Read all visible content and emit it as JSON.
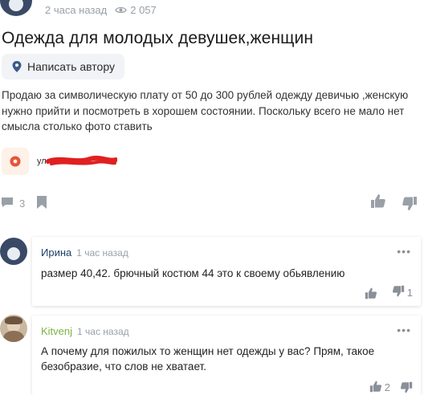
{
  "post": {
    "time": "2 часа назад",
    "views": "2 057",
    "title": "Одежда для молодых девушек,женщин",
    "write_author": "Написать автору",
    "description": "Продаю за символическую плату от 50 до 300 рублей одежду девичью ,женскую нужно прийти и посмотреть в хорошем состоянии. Поскольку всего не мало нет смысла столько фото ставить",
    "location_text": "ул.",
    "comments_count": "3"
  },
  "comments": [
    {
      "author": "Ирина",
      "time": "1 час назад",
      "text": "размер 40,42. брючный костюм 44 это к своему обьявлению",
      "dislikes": "1",
      "name_color": "#1a3f66"
    },
    {
      "author": "Kitvenj",
      "time": "1 час назад",
      "text": "А почему для пожилых то женщин нет одежды у вас? Прям, такое безобразие, что слов не хватает.",
      "likes": "2",
      "name_color": "#7cb342"
    }
  ],
  "colors": {
    "accent": "#3a4a66",
    "muted": "#9aa0a8",
    "button_bg": "#f1f3f6",
    "location_pin": "#e8533a",
    "redaction": "#e02020"
  },
  "icons": {
    "eye": "eye-icon",
    "pin": "pin-icon",
    "comment": "comment-icon",
    "bookmark": "bookmark-icon",
    "like": "thumb-up-icon",
    "dislike": "thumb-down-icon",
    "more": "more-dots-icon"
  }
}
